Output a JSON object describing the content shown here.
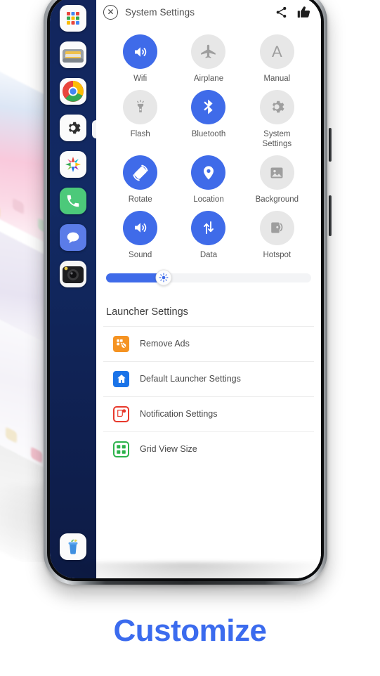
{
  "header": {
    "title": "System Settings",
    "close_icon": "close-circle-icon",
    "share_icon": "share-icon",
    "like_icon": "thumbs-up-icon"
  },
  "colors": {
    "accent_blue": "#3f6be9",
    "inactive_gray": "#e7e7e7",
    "inactive_glyph": "#9e9e9e",
    "caption_blue": "#3b6bee",
    "sidebar_navy": "#12255c"
  },
  "toggles": [
    {
      "label": "Wifi",
      "icon": "volume-icon",
      "state": "on"
    },
    {
      "label": "Airplane",
      "icon": "airplane-icon",
      "state": "off"
    },
    {
      "label": "Manual",
      "icon": "letter-a-icon",
      "state": "off"
    },
    {
      "label": "Flash",
      "icon": "flashlight-icon",
      "state": "off"
    },
    {
      "label": "Bluetooth",
      "icon": "bluetooth-icon",
      "state": "on"
    },
    {
      "label": "System Settings",
      "icon": "gear-icon",
      "state": "off"
    },
    {
      "label": "Rotate",
      "icon": "rotate-icon",
      "state": "on"
    },
    {
      "label": "Location",
      "icon": "location-pin-icon",
      "state": "on"
    },
    {
      "label": "Background",
      "icon": "image-icon",
      "state": "off"
    },
    {
      "label": "Sound",
      "icon": "volume-icon",
      "state": "on"
    },
    {
      "label": "Data",
      "icon": "data-arrows-icon",
      "state": "on"
    },
    {
      "label": "Hotspot",
      "icon": "hotspot-icon",
      "state": "off"
    }
  ],
  "brightness": {
    "icon": "brightness-sun-icon",
    "value_percent": 28
  },
  "launcher": {
    "section_title": "Launcher Settings",
    "items": [
      {
        "label": "Remove Ads",
        "icon": "remove-ads-icon",
        "color": "#f59322"
      },
      {
        "label": "Default Launcher Settings",
        "icon": "home-icon",
        "color": "#1a73e8"
      },
      {
        "label": "Notification Settings",
        "icon": "notification-icon",
        "color": "#e8392c"
      },
      {
        "label": "Grid View Size",
        "icon": "grid-view-icon",
        "color": "#2cb24b"
      }
    ]
  },
  "sidebar": {
    "apps": [
      {
        "name": "app-drawer-icon"
      },
      {
        "name": "files-icon"
      },
      {
        "name": "chrome-icon"
      },
      {
        "name": "settings-gear-icon"
      },
      {
        "name": "gallery-icon"
      },
      {
        "name": "phone-icon"
      },
      {
        "name": "messages-icon"
      },
      {
        "name": "camera-icon"
      }
    ],
    "trash": {
      "name": "trash-icon"
    },
    "handle": {
      "name": "sidebar-handle"
    }
  },
  "caption": {
    "text": "Customize"
  }
}
